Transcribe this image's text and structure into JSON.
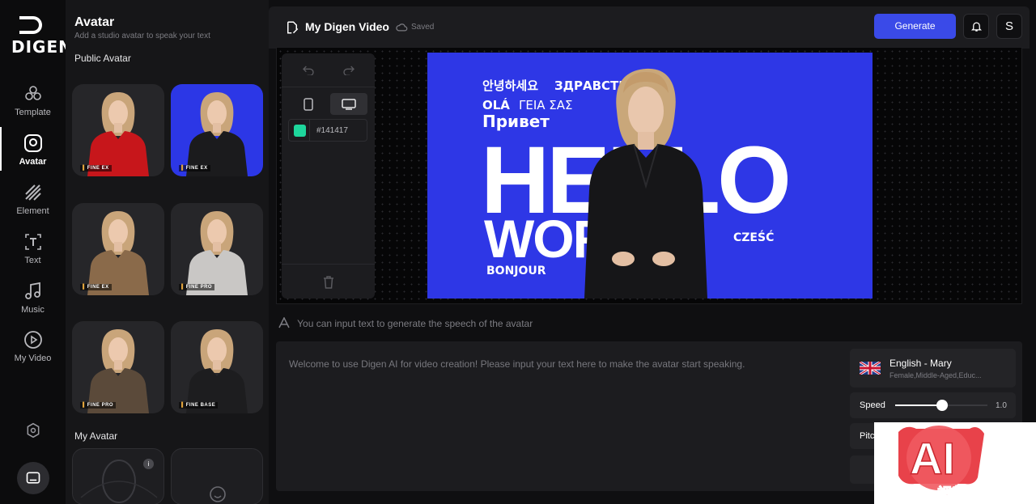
{
  "brand": {
    "name": "DIGEN"
  },
  "nav": {
    "items": [
      {
        "label": "Template",
        "icon": "template-icon"
      },
      {
        "label": "Avatar",
        "icon": "avatar-icon",
        "active": true
      },
      {
        "label": "Element",
        "icon": "element-icon"
      },
      {
        "label": "Text",
        "icon": "text-icon"
      },
      {
        "label": "Music",
        "icon": "music-icon"
      },
      {
        "label": "My Video",
        "icon": "video-icon"
      }
    ]
  },
  "panel": {
    "title": "Avatar",
    "subtitle": "Add a studio avatar to speak your text",
    "public_heading": "Public Avatar",
    "my_heading": "My Avatar",
    "public_avatars": [
      {
        "tag": "FINE EX",
        "outfit": "#c7161b",
        "bg": "#262629"
      },
      {
        "tag": "FINE EX",
        "outfit": "#1b1b1d",
        "bg": "#2c37e6"
      },
      {
        "tag": "FINE EX",
        "outfit": "#8a6a4a",
        "bg": "#262629"
      },
      {
        "tag": "FINE PRO",
        "outfit": "#c9c7c5",
        "bg": "#262629"
      },
      {
        "tag": "FINE PRO",
        "outfit": "#5b4a3a",
        "bg": "#262629"
      },
      {
        "tag": "FINE BASE",
        "outfit": "#1d1d1f",
        "bg": "#262629"
      }
    ]
  },
  "editor": {
    "project_title": "My Digen Video",
    "saved_label": "Saved",
    "generate_label": "Generate",
    "profile_initial": "S",
    "bg_color_value": "#141417",
    "helper_text": "You can input text to generate the speech of the avatar",
    "text_placeholder": "Welcome to use Digen AI for video creation! Please input your text here to make the avatar start speaking.",
    "voice": {
      "name": "English - Mary",
      "desc": "Female,Middle-Aged,Educ..."
    },
    "speed": {
      "label": "Speed",
      "value": "1.0",
      "level": 0.5
    },
    "pitch": {
      "label": "Pitc"
    }
  },
  "canvas": {
    "background": "#2e37e6",
    "greetings": [
      "안녕하세요",
      "ЗДРАВСТВУЙ",
      "OLÁ",
      "ΓΕΙΑ ΣΑΣ",
      "Привет",
      "HELLO",
      "WORLD",
      "CZEŚĆ",
      "BONJOUR"
    ]
  },
  "watermark": {
    "main": "AI",
    "sub": "视频贴吧"
  }
}
